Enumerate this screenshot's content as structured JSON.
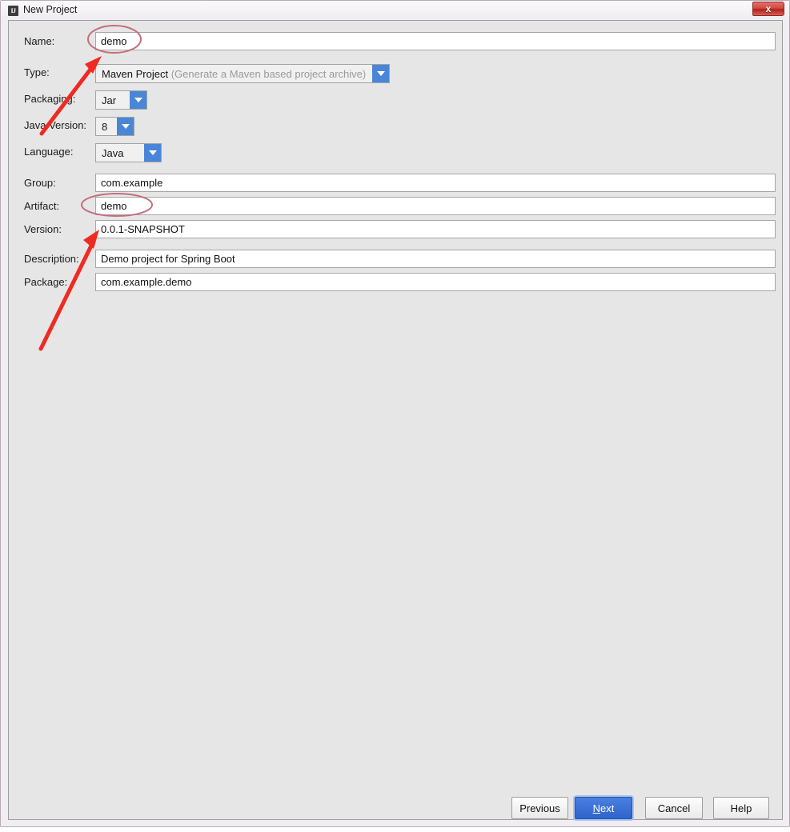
{
  "window": {
    "title": "New Project",
    "icon": "intellij-idea-icon",
    "icon_glyph": "IJ",
    "close_label": "x"
  },
  "form": {
    "rows": [
      {
        "label": "Name:",
        "kind": "text",
        "value": "demo"
      },
      {
        "label": "Type:",
        "kind": "combo",
        "value": "Maven Project",
        "hint": "(Generate a Maven based project archive)"
      },
      {
        "label": "Packaging:",
        "kind": "combo",
        "value": "Jar"
      },
      {
        "label": "Java Version:",
        "kind": "combo",
        "value": "8"
      },
      {
        "label": "Language:",
        "kind": "combo",
        "value": "Java"
      },
      {
        "label": "Group:",
        "kind": "text",
        "value": "com.example"
      },
      {
        "label": "Artifact:",
        "kind": "text",
        "value": "demo"
      },
      {
        "label": "Version:",
        "kind": "text",
        "value": "0.0.1-SNAPSHOT"
      },
      {
        "label": "Description:",
        "kind": "text",
        "value": "Demo project for Spring Boot"
      },
      {
        "label": "Package:",
        "kind": "text",
        "value": "com.example.demo"
      }
    ]
  },
  "footer": {
    "previous_label": "Previous",
    "next_label": "Next",
    "next_mnemonic": "N",
    "next_rest": "ext",
    "cancel_label": "Cancel",
    "help_label": "Help"
  },
  "annotations": {
    "color": "#ee2b22",
    "ellipse_color": "#c0707e",
    "arrow_count": 2,
    "ellipse_count": 2
  },
  "colors": {
    "panel_bg": "#e7e6e6",
    "combo_accent": "#4a86d8",
    "primary_button": "#2f63cc",
    "close_button": "#c4362c",
    "field_bg": "#ffffff"
  }
}
